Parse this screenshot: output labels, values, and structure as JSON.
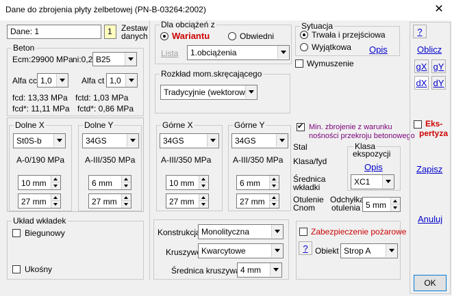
{
  "window": {
    "title": "Dane do zbrojenia płyty żelbetowej (PN-B-03264:2002)",
    "close_glyph": "✕"
  },
  "top_left": {
    "name_value": "Dane: 1",
    "set_number": "1",
    "set_label_line1": "Zestaw",
    "set_label_line2": "danych"
  },
  "beton": {
    "title": "Beton",
    "ecm": "Ecm:29900 MPa",
    "ni_label": "ni:0,2",
    "class_value": "B25",
    "alfa_cc_label": "Alfa cc",
    "alfa_cc_value": "1,0",
    "alfa_ct_label": "Alfa ct",
    "alfa_ct_value": "1,0",
    "fcd": "fcd: 13,33 MPa",
    "fctd": "fctd: 1,03 MPa",
    "fcd_star": "fcd*: 11,11 MPa",
    "fctd_star": "fctd*: 0,86 MPa"
  },
  "obciazenia": {
    "title": "Dla obciążeń z",
    "wariantu_label": "Wariantu",
    "obwiedni_label": "Obwiedni",
    "lista_label": "Lista",
    "lista_value": "1.obciążenia"
  },
  "sytuacja": {
    "title": "Sytuacja",
    "trwala_label": "Trwała i przejściowa",
    "wyjatkowa_label": "Wyjątkowa",
    "opis_link": "Opis"
  },
  "wymuszenie_label": "Wymuszenie",
  "rozklad": {
    "title": "Rozkład mom.skręcającego",
    "value": "Tradycyjnie (wektorowo)"
  },
  "dolne_x": {
    "title": "Dolne X",
    "steel": "St0S-b",
    "grade": "A-0/190 MPa",
    "diameter": "10 mm",
    "cover": "27 mm"
  },
  "dolne_y": {
    "title": "Dolne Y",
    "steel": "34GS",
    "grade": "A-III/350 MPa",
    "diameter": "6 mm",
    "cover": "27 mm"
  },
  "gorne_x": {
    "title": "Górne X",
    "steel": "34GS",
    "grade": "A-III/350 MPa",
    "diameter": "10 mm",
    "cover": "27 mm"
  },
  "gorne_y": {
    "title": "Górne Y",
    "steel": "34GS",
    "grade": "A-III/350 MPa",
    "diameter": "6 mm",
    "cover": "27 mm"
  },
  "min_zbrojenie": {
    "line1": "Min. zbrojenie z warunku",
    "line2": "nośności przekroju betonowego"
  },
  "stal_panel": {
    "stal_label": "Stal",
    "klasa_fyd_label": "Klasa/fyd",
    "srednica_line1": "Średnica",
    "srednica_line2": "wkładki",
    "otulenie_line1": "Otulenie",
    "otulenie_line2": "Cnom",
    "odchylka_line1": "Odchyłka",
    "odchylka_line2": "otulenia",
    "odchylka_value": "5 mm"
  },
  "klasa_ekspozycji": {
    "title_line1": "Klasa",
    "title_line2": "ekspozycji",
    "opis_link": "Opis",
    "value": "XC1"
  },
  "uklad": {
    "title": "Układ wkładek",
    "biegunowy_label": "Biegunowy",
    "ukosny_label": "Ukośny"
  },
  "konstrukcja": {
    "konstrukcja_label": "Konstrukcja",
    "konstrukcja_value": "Monolityczna",
    "kruszywo_label": "Kruszywo",
    "kruszywo_value": "Kwarcytowe",
    "srednica_label": "Średnica kruszywa",
    "srednica_value": "4 mm"
  },
  "pozar": {
    "label": "Zabezpieczenie pożarowe",
    "help_glyph": "?",
    "obiekt_label": "Obiekt",
    "obiekt_value": "Strop A"
  },
  "side": {
    "help_glyph": "?",
    "oblicz": "Oblicz",
    "gx": "gX",
    "gy": "gY",
    "dx": "dX",
    "dy": "dY",
    "ekspertyza_line1": "Eks-",
    "ekspertyza_line2": "pertyza",
    "zapisz": "Zapisz",
    "anuluj": "Anuluj",
    "ok": "OK"
  },
  "colors": {
    "accent_red": "#cc0000",
    "link_blue": "#0000cc",
    "purple_text": "#7a007a"
  }
}
